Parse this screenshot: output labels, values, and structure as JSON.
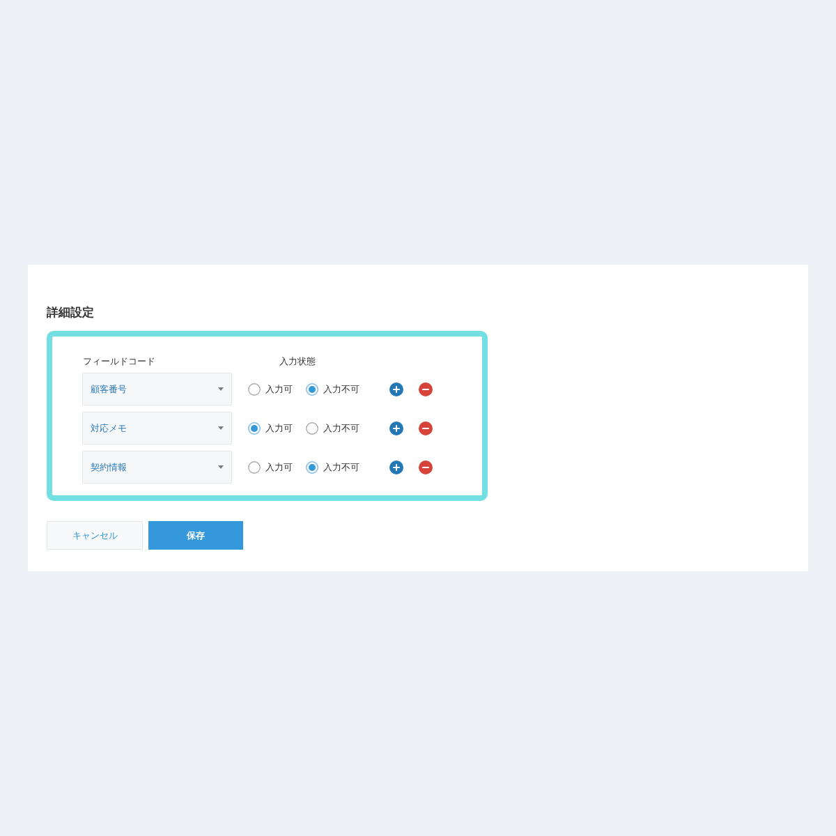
{
  "title": "詳細設定",
  "settings": {
    "columns": [
      "フィールドコード",
      "入力状態"
    ],
    "rows": [
      {
        "field": "顧客番号",
        "options": [
          {
            "label": "入力可",
            "selected": false
          },
          {
            "label": "入力不可",
            "selected": true
          }
        ]
      },
      {
        "field": "対応メモ",
        "options": [
          {
            "label": "入力可",
            "selected": true
          },
          {
            "label": "入力不可",
            "selected": false
          }
        ]
      },
      {
        "field": "契約情報",
        "options": [
          {
            "label": "入力可",
            "selected": false
          },
          {
            "label": "入力不可",
            "selected": true
          }
        ]
      }
    ]
  },
  "buttons": [
    {
      "label": "キャンセル",
      "kind": "secondary"
    },
    {
      "label": "保存",
      "kind": "primary"
    }
  ]
}
